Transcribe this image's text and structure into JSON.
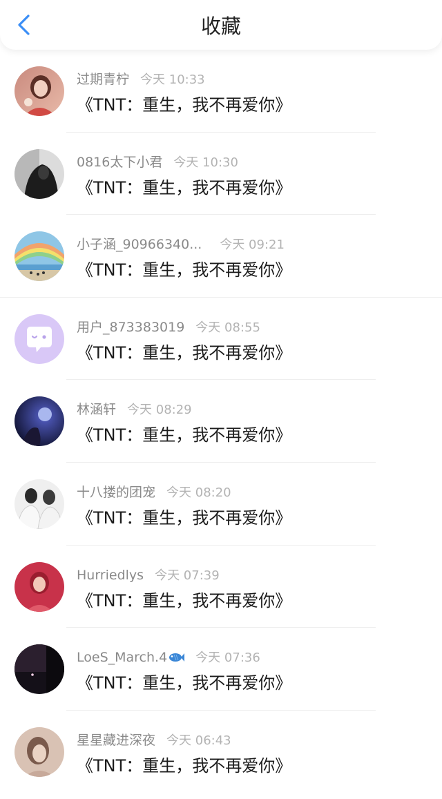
{
  "header": {
    "title": "收藏",
    "back_icon": "chevron-left-icon",
    "accent_color": "#3a8ef6"
  },
  "favorites": [
    {
      "name": "过期青柠",
      "time": "今天 10:33",
      "message": "《TNT：重生，我不再爱你》"
    },
    {
      "name": "0816太下小君",
      "time": "今天 10:30",
      "message": "《TNT：重生，我不再爱你》"
    },
    {
      "name": "小子涵_90966340...",
      "time": "今天 09:21",
      "message": "《TNT：重生，我不再爱你》"
    },
    {
      "name": "用户_873383019",
      "time": "今天 08:55",
      "message": "《TNT：重生，我不再爱你》"
    },
    {
      "name": "林涵轩",
      "time": "今天 08:29",
      "message": "《TNT：重生，我不再爱你》"
    },
    {
      "name": "十八搂的团宠",
      "time": "今天 08:20",
      "message": "《TNT：重生，我不再爱你》"
    },
    {
      "name": "Hurriedlys",
      "time": "今天 07:39",
      "message": "《TNT：重生，我不再爱你》"
    },
    {
      "name": "LoeS_March.4",
      "name_icon": "fish-emoji-icon",
      "time": "今天 07:36",
      "message": "《TNT：重生，我不再爱你》"
    },
    {
      "name": "星星藏进深夜",
      "time": "今天 06:43",
      "message": "《TNT：重生，我不再爱你》"
    }
  ]
}
